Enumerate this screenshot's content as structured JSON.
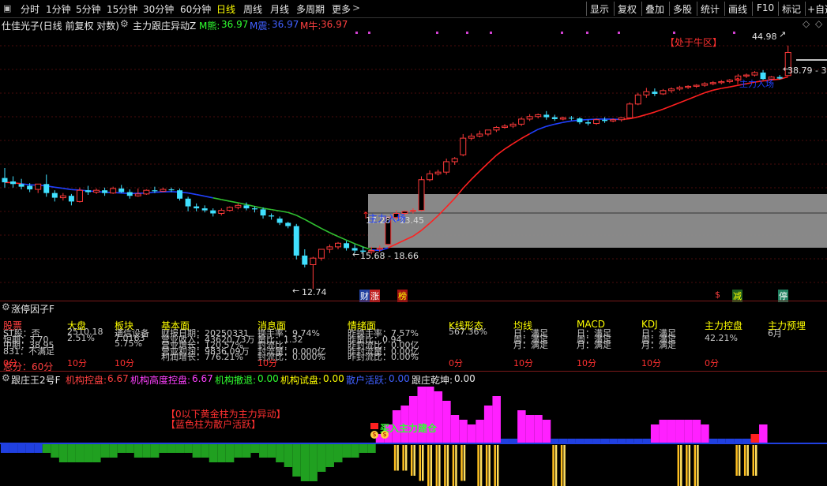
{
  "toolbar": {
    "timeframes": [
      "分时",
      "1分钟",
      "5分钟",
      "15分钟",
      "30分钟",
      "60分钟",
      "日线",
      "周线",
      "月线",
      "多周期",
      "更多"
    ],
    "active_timeframe": "日线",
    "more_arrow": ">",
    "right_buttons": [
      "显示",
      "复权",
      "叠加",
      "多股",
      "统计",
      "画线",
      "F10",
      "标记",
      "+自选"
    ]
  },
  "main_header": {
    "title": "仕佳光子(日线 前复权 对数)",
    "indicator_name": "主力跟庄异动Z",
    "values": [
      {
        "label": "M熊:",
        "value": "36.97",
        "color": "#30ff30"
      },
      {
        "label": "M震:",
        "value": "36.97",
        "color": "#4060ff"
      },
      {
        "label": "M牛:",
        "value": "36.97",
        "color": "#ff4040"
      }
    ],
    "nav_icons": [
      "◇",
      "◇"
    ]
  },
  "main_chart": {
    "annotations": {
      "bull_zone": "【处于牛区】",
      "high_price": "44.98",
      "price_range_right": "38.79 - 3",
      "entry_right": "主力入场",
      "entry_left": "主力入场",
      "zone_range_top": "17.28 - 13.45",
      "zone_range_bottom": "15.68 - 18.66",
      "low_price": "12.74",
      "tag_cai": "财",
      "tag_zhang": "涨",
      "tag_bang": "榜",
      "tag_s": "$",
      "tag_jian": "减",
      "tag_ting": "停"
    },
    "candles": [
      {
        "o": 22.6,
        "h": 23.8,
        "c": 22.1,
        "l": 21.5
      },
      {
        "o": 22.2,
        "h": 22.8,
        "c": 21.9,
        "l": 21.5
      },
      {
        "o": 21.9,
        "h": 22.5,
        "c": 21.6,
        "l": 21.3
      },
      {
        "o": 21.7,
        "h": 22.0,
        "c": 21.3,
        "l": 21.0
      },
      {
        "o": 21.3,
        "h": 21.8,
        "c": 21.9,
        "l": 20.9
      },
      {
        "o": 21.9,
        "h": 23.0,
        "c": 20.9,
        "l": 20.5
      },
      {
        "o": 20.9,
        "h": 21.2,
        "c": 20.4,
        "l": 20.0
      },
      {
        "o": 20.4,
        "h": 20.9,
        "c": 20.6,
        "l": 20.1
      },
      {
        "o": 20.6,
        "h": 20.8,
        "c": 20.0,
        "l": 19.6
      },
      {
        "o": 20.0,
        "h": 21.5,
        "c": 21.2,
        "l": 19.9
      },
      {
        "o": 21.2,
        "h": 21.7,
        "c": 21.0,
        "l": 20.7
      },
      {
        "o": 21.0,
        "h": 21.4,
        "c": 21.2,
        "l": 20.8
      },
      {
        "o": 21.2,
        "h": 21.5,
        "c": 20.9,
        "l": 20.6
      },
      {
        "o": 20.9,
        "h": 21.6,
        "c": 21.4,
        "l": 20.8
      },
      {
        "o": 21.4,
        "h": 21.8,
        "c": 21.0,
        "l": 20.9
      },
      {
        "o": 21.0,
        "h": 21.3,
        "c": 20.6,
        "l": 20.3
      },
      {
        "o": 20.6,
        "h": 21.4,
        "c": 20.8,
        "l": 20.5
      },
      {
        "o": 20.8,
        "h": 21.3,
        "c": 21.2,
        "l": 20.7
      },
      {
        "o": 21.2,
        "h": 21.6,
        "c": 21.1,
        "l": 20.9
      },
      {
        "o": 21.1,
        "h": 21.5,
        "c": 21.3,
        "l": 21.0
      },
      {
        "o": 21.3,
        "h": 21.5,
        "c": 21.2,
        "l": 21.0
      },
      {
        "o": 21.2,
        "h": 21.4,
        "c": 20.3,
        "l": 20.1
      },
      {
        "o": 20.3,
        "h": 20.5,
        "c": 19.5,
        "l": 19.0
      },
      {
        "o": 19.5,
        "h": 19.8,
        "c": 19.3,
        "l": 19.0
      },
      {
        "o": 19.3,
        "h": 19.6,
        "c": 19.1,
        "l": 18.9
      },
      {
        "o": 19.1,
        "h": 19.3,
        "c": 18.8,
        "l": 18.5
      },
      {
        "o": 18.8,
        "h": 19.3,
        "c": 19.1,
        "l": 18.6
      },
      {
        "o": 19.1,
        "h": 19.5,
        "c": 19.4,
        "l": 19.0
      },
      {
        "o": 19.4,
        "h": 19.8,
        "c": 19.6,
        "l": 19.2
      },
      {
        "o": 19.6,
        "h": 19.9,
        "c": 19.3,
        "l": 19.1
      },
      {
        "o": 19.3,
        "h": 19.5,
        "c": 19.2,
        "l": 18.9
      },
      {
        "o": 19.2,
        "h": 19.4,
        "c": 18.6,
        "l": 18.3
      },
      {
        "o": 18.6,
        "h": 18.8,
        "c": 18.5,
        "l": 18.2
      },
      {
        "o": 18.3,
        "h": 18.5,
        "c": 17.9,
        "l": 17.7
      },
      {
        "o": 17.9,
        "h": 18.0,
        "c": 17.6,
        "l": 17.4
      },
      {
        "o": 17.6,
        "h": 17.8,
        "c": 15.1,
        "l": 14.8
      },
      {
        "o": 15.1,
        "h": 15.6,
        "c": 14.4,
        "l": 14.2
      },
      {
        "o": 14.4,
        "h": 15.0,
        "c": 14.9,
        "l": 12.7
      },
      {
        "o": 14.9,
        "h": 15.2,
        "c": 15.6,
        "l": 14.7
      },
      {
        "o": 15.6,
        "h": 16.0,
        "c": 15.8,
        "l": 15.3
      },
      {
        "o": 15.8,
        "h": 16.2,
        "c": 16.1,
        "l": 15.6
      },
      {
        "o": 16.1,
        "h": 16.3,
        "c": 15.7,
        "l": 15.5
      },
      {
        "o": 15.7,
        "h": 16.0,
        "c": 15.5,
        "l": 15.3
      },
      {
        "o": 15.5,
        "h": 15.8,
        "c": 15.4,
        "l": 15.1
      },
      {
        "o": 15.4,
        "h": 15.8,
        "c": 15.5,
        "l": 15.2
      },
      {
        "o": 15.6,
        "h": 15.9,
        "c": 15.7,
        "l": 15.4
      },
      {
        "o": 16.0,
        "h": 18.5,
        "c": 18.4,
        "l": 15.9
      },
      {
        "o": 18.4,
        "h": 19.1,
        "c": 18.8,
        "l": 18.2
      },
      {
        "o": 18.8,
        "h": 19.1,
        "c": 19.0,
        "l": 18.6
      },
      {
        "o": 19.0,
        "h": 19.3,
        "c": 19.1,
        "l": 18.8
      },
      {
        "o": 19.1,
        "h": 22.8,
        "c": 22.4,
        "l": 19.0
      },
      {
        "o": 22.4,
        "h": 23.5,
        "c": 23.1,
        "l": 22.2
      },
      {
        "o": 23.1,
        "h": 23.6,
        "c": 23.3,
        "l": 22.9
      },
      {
        "o": 23.3,
        "h": 25.0,
        "c": 24.6,
        "l": 23.0
      },
      {
        "o": 24.6,
        "h": 25.2,
        "c": 25.0,
        "l": 24.2
      },
      {
        "o": 25.5,
        "h": 28.4,
        "c": 27.8,
        "l": 25.3
      },
      {
        "o": 27.8,
        "h": 28.5,
        "c": 28.1,
        "l": 27.5
      },
      {
        "o": 28.1,
        "h": 28.9,
        "c": 28.4,
        "l": 27.9
      },
      {
        "o": 28.4,
        "h": 28.9,
        "c": 29.0,
        "l": 28.1
      },
      {
        "o": 29.0,
        "h": 29.6,
        "c": 29.4,
        "l": 28.7
      },
      {
        "o": 29.4,
        "h": 29.9,
        "c": 29.6,
        "l": 29.2
      },
      {
        "o": 29.6,
        "h": 30.2,
        "c": 29.9,
        "l": 29.3
      },
      {
        "o": 29.9,
        "h": 31.0,
        "c": 30.7,
        "l": 29.6
      },
      {
        "o": 30.7,
        "h": 31.5,
        "c": 31.1,
        "l": 30.4
      },
      {
        "o": 31.1,
        "h": 31.6,
        "c": 31.4,
        "l": 30.8
      },
      {
        "o": 31.4,
        "h": 32.0,
        "c": 31.0,
        "l": 30.6
      },
      {
        "o": 31.0,
        "h": 31.4,
        "c": 30.7,
        "l": 30.4
      },
      {
        "o": 30.7,
        "h": 31.1,
        "c": 30.9,
        "l": 30.5
      },
      {
        "o": 30.9,
        "h": 31.2,
        "c": 30.8,
        "l": 30.5
      },
      {
        "o": 30.8,
        "h": 31.0,
        "c": 30.2,
        "l": 29.9
      },
      {
        "o": 30.2,
        "h": 30.6,
        "c": 30.0,
        "l": 29.7
      },
      {
        "o": 30.0,
        "h": 30.8,
        "c": 30.6,
        "l": 29.8
      },
      {
        "o": 30.6,
        "h": 31.0,
        "c": 30.4,
        "l": 30.1
      },
      {
        "o": 30.4,
        "h": 30.8,
        "c": 30.6,
        "l": 30.2
      },
      {
        "o": 30.6,
        "h": 31.0,
        "c": 30.9,
        "l": 30.3
      },
      {
        "o": 30.9,
        "h": 33.5,
        "c": 33.2,
        "l": 30.8
      },
      {
        "o": 33.2,
        "h": 35.2,
        "c": 34.8,
        "l": 33.0
      },
      {
        "o": 34.8,
        "h": 36.1,
        "c": 35.4,
        "l": 34.3
      },
      {
        "o": 35.4,
        "h": 36.0,
        "c": 35.0,
        "l": 34.6
      },
      {
        "o": 35.0,
        "h": 35.9,
        "c": 35.6,
        "l": 34.8
      },
      {
        "o": 35.6,
        "h": 36.2,
        "c": 35.9,
        "l": 35.2
      },
      {
        "o": 35.9,
        "h": 36.5,
        "c": 36.2,
        "l": 35.6
      },
      {
        "o": 36.2,
        "h": 36.6,
        "c": 36.4,
        "l": 35.9
      },
      {
        "o": 36.4,
        "h": 36.8,
        "c": 36.6,
        "l": 36.1
      },
      {
        "o": 36.6,
        "h": 37.2,
        "c": 36.9,
        "l": 36.3
      },
      {
        "o": 36.9,
        "h": 37.4,
        "c": 37.1,
        "l": 36.6
      },
      {
        "o": 37.1,
        "h": 37.6,
        "c": 37.3,
        "l": 36.8
      },
      {
        "o": 37.3,
        "h": 37.8,
        "c": 37.6,
        "l": 37.0
      },
      {
        "o": 37.6,
        "h": 38.8,
        "c": 38.4,
        "l": 37.3
      },
      {
        "o": 38.4,
        "h": 38.9,
        "c": 38.6,
        "l": 38.0
      },
      {
        "o": 38.6,
        "h": 39.4,
        "c": 39.1,
        "l": 38.3
      },
      {
        "o": 39.1,
        "h": 39.6,
        "c": 37.8,
        "l": 37.6
      },
      {
        "o": 37.8,
        "h": 38.4,
        "c": 38.2,
        "l": 37.5
      },
      {
        "o": 38.2,
        "h": 38.6,
        "c": 37.9,
        "l": 37.7
      },
      {
        "o": 38.5,
        "h": 45.0,
        "c": 43.4,
        "l": 38.4
      }
    ]
  },
  "factor_panel": {
    "title": "涨停因子F",
    "headers": [
      {
        "text": "股票",
        "color": "#ff4040"
      },
      {
        "text": "大盘",
        "color": "#ffff00"
      },
      {
        "text": "板块",
        "color": "#ffff00"
      },
      {
        "text": "基本面",
        "color": "#ffff00"
      },
      {
        "text": "消息面",
        "color": "#ffff00"
      },
      {
        "text": "情绪面",
        "color": "#ffff00"
      },
      {
        "text": "K线形态",
        "color": "#ffff00"
      },
      {
        "text": "均线",
        "color": "#ffff00"
      },
      {
        "text": "MACD",
        "color": "#ffff00"
      },
      {
        "text": "KDJ",
        "color": "#ffff00"
      },
      {
        "text": "主力控盘",
        "color": "#ffff00"
      },
      {
        "text": "主力预埋",
        "color": "#ffff00"
      }
    ],
    "rows": [
      [
        "ST股：否",
        "2510.18",
        "通信设备",
        "财报日期：20250331",
        "换手率：9.74%",
        "昨换手率：7.57%",
        "567.36%",
        "日：满足",
        "日：满足",
        "日：满足",
        "",
        "6月"
      ],
      [
        "短期：3.70",
        "2.51%",
        "7.0163",
        "营业收入：43620.73万",
        "量比：1.32",
        "昨量比：0.94",
        "",
        "周：满足",
        "周：满足",
        "周：满足",
        "42.21%",
        ""
      ],
      [
        "中期：38.95",
        "",
        "5.75%",
        "营业增长：120.57%",
        "封流比：",
        "昨封流比：0.00亿",
        "",
        "月：满足",
        "月：满足",
        "月：满足",
        "",
        ""
      ],
      [
        "831：不满足",
        "",
        "",
        "营业利润：9836.09万",
        "封流量：0.000亿",
        "昨封流量：0.00亿",
        "",
        "",
        "",
        "",
        "",
        ""
      ],
      [
        "",
        "",
        "",
        "利润增长：776.21%",
        "封流比：0.000%",
        "昨封流比：0.00%",
        "",
        "",
        "",
        "",
        "",
        ""
      ]
    ],
    "scores": [
      "0分",
      "10分",
      "10分",
      "",
      "10分",
      "",
      "0分",
      "10分",
      "10分",
      "10分",
      "0分",
      ""
    ],
    "total": "总分：60分"
  },
  "lower_panel": {
    "title": "跟庄王2号F",
    "values": [
      {
        "label": "机构控盘:",
        "value": "6.67",
        "color": "#ff4040"
      },
      {
        "label": "机构高度控盘:",
        "value": "6.67",
        "color": "#ff40ff"
      },
      {
        "label": "机构撤退:",
        "value": "0.00",
        "color": "#30ff30"
      },
      {
        "label": "机构试盘:",
        "value": "0.00",
        "color": "#ffff00"
      },
      {
        "label": "散户活跃:",
        "value": "0.00",
        "color": "#4060ff"
      },
      {
        "label": "跟庄乾坤:",
        "value": "0.00",
        "color": "#e8e8e8"
      }
    ],
    "note_line1": "【0以下黄金柱为主力异动】",
    "note_line2": "【蓝色柱为散户活跃】",
    "callout": "买入主力建仓",
    "bars": [
      {
        "v": -2,
        "c": "blue"
      },
      {
        "v": -2,
        "c": "blue"
      },
      {
        "v": -2,
        "c": "blue"
      },
      {
        "v": -2,
        "c": "blue"
      },
      {
        "v": -2,
        "c": "blue"
      },
      {
        "v": -2,
        "c": "green"
      },
      {
        "v": -3,
        "c": "green"
      },
      {
        "v": -4,
        "c": "green"
      },
      {
        "v": -4,
        "c": "green"
      },
      {
        "v": -4,
        "c": "green"
      },
      {
        "v": -4,
        "c": "green"
      },
      {
        "v": -4,
        "c": "green"
      },
      {
        "v": -3,
        "c": "green"
      },
      {
        "v": -3,
        "c": "green"
      },
      {
        "v": -2,
        "c": "green"
      },
      {
        "v": -2,
        "c": "green"
      },
      {
        "v": -3,
        "c": "green"
      },
      {
        "v": -3,
        "c": "green"
      },
      {
        "v": -3,
        "c": "green"
      },
      {
        "v": -2,
        "c": "green"
      },
      {
        "v": -2,
        "c": "green"
      },
      {
        "v": -2,
        "c": "green"
      },
      {
        "v": -2,
        "c": "green"
      },
      {
        "v": -3,
        "c": "green"
      },
      {
        "v": -3,
        "c": "green"
      },
      {
        "v": -4,
        "c": "green"
      },
      {
        "v": -4,
        "c": "green"
      },
      {
        "v": -4,
        "c": "green"
      },
      {
        "v": -3,
        "c": "green"
      },
      {
        "v": -3,
        "c": "green"
      },
      {
        "v": -2,
        "c": "green"
      },
      {
        "v": -3,
        "c": "green"
      },
      {
        "v": -3,
        "c": "green"
      },
      {
        "v": -4,
        "c": "green"
      },
      {
        "v": -5,
        "c": "green"
      },
      {
        "v": -7,
        "c": "green"
      },
      {
        "v": -8,
        "c": "green"
      },
      {
        "v": -8,
        "c": "green"
      },
      {
        "v": -6,
        "c": "green"
      },
      {
        "v": -5,
        "c": "green"
      },
      {
        "v": -4,
        "c": "green"
      },
      {
        "v": -3,
        "c": "green"
      },
      {
        "v": -3,
        "c": "green"
      },
      {
        "v": -2,
        "c": "green"
      },
      {
        "v": -2,
        "c": "green"
      },
      {
        "v": 2,
        "c": "magenta"
      },
      {
        "v": 4,
        "c": "magenta"
      },
      {
        "v": 7,
        "c": "magenta"
      },
      {
        "v": 8,
        "c": "magenta"
      },
      {
        "v": 10,
        "c": "magenta"
      },
      {
        "v": 12,
        "c": "magenta"
      },
      {
        "v": 12,
        "c": "magenta"
      },
      {
        "v": 11,
        "c": "magenta"
      },
      {
        "v": 9,
        "c": "magenta"
      },
      {
        "v": 6,
        "c": "magenta"
      },
      {
        "v": 5,
        "c": "magenta"
      },
      {
        "v": 4,
        "c": "magenta"
      },
      {
        "v": 5,
        "c": "magenta"
      },
      {
        "v": 8,
        "c": "magenta"
      },
      {
        "v": 10,
        "c": "magenta"
      },
      {
        "v": 1,
        "c": "blue"
      },
      {
        "v": 1,
        "c": "blue"
      },
      {
        "v": 7,
        "c": "magenta"
      },
      {
        "v": 6,
        "c": "magenta"
      },
      {
        "v": 6,
        "c": "magenta"
      },
      {
        "v": 5,
        "c": "magenta"
      },
      {
        "v": 1,
        "c": "blue"
      },
      {
        "v": 1,
        "c": "blue"
      },
      {
        "v": 1,
        "c": "blue"
      },
      {
        "v": 1,
        "c": "blue"
      },
      {
        "v": 1,
        "c": "blue"
      },
      {
        "v": 1,
        "c": "blue"
      },
      {
        "v": 1,
        "c": "blue"
      },
      {
        "v": 1,
        "c": "blue"
      },
      {
        "v": 1,
        "c": "blue"
      },
      {
        "v": 1,
        "c": "blue"
      },
      {
        "v": 1,
        "c": "blue"
      },
      {
        "v": 1,
        "c": "blue"
      },
      {
        "v": 4,
        "c": "magenta"
      },
      {
        "v": 5,
        "c": "magenta"
      },
      {
        "v": 5,
        "c": "magenta"
      },
      {
        "v": 5,
        "c": "magenta"
      },
      {
        "v": 5,
        "c": "magenta"
      },
      {
        "v": 5,
        "c": "magenta"
      },
      {
        "v": 4,
        "c": "magenta"
      },
      {
        "v": 1,
        "c": "blue"
      },
      {
        "v": 1,
        "c": "blue"
      },
      {
        "v": 1,
        "c": "blue"
      },
      {
        "v": 1,
        "c": "blue"
      },
      {
        "v": 1,
        "c": "blue"
      },
      {
        "v": 2,
        "c": "red"
      },
      {
        "v": 4,
        "c": "magenta"
      }
    ],
    "gold_bars": [
      {
        "i": 45,
        "v": 0
      },
      {
        "i": 47,
        "v": 5
      },
      {
        "i": 48,
        "v": 5
      },
      {
        "i": 49,
        "v": 6
      },
      {
        "i": 50,
        "v": 7
      },
      {
        "i": 51,
        "v": 8
      },
      {
        "i": 52,
        "v": 8
      },
      {
        "i": 53,
        "v": 8
      },
      {
        "i": 54,
        "v": 8
      },
      {
        "i": 55,
        "v": 7
      },
      {
        "i": 57,
        "v": 8
      },
      {
        "i": 58,
        "v": 8
      },
      {
        "i": 59,
        "v": 8
      },
      {
        "i": 66,
        "v": 8
      },
      {
        "i": 67,
        "v": 8
      },
      {
        "i": 81,
        "v": 8
      },
      {
        "i": 82,
        "v": 8
      },
      {
        "i": 83,
        "v": 8
      },
      {
        "i": 88,
        "v": 6
      },
      {
        "i": 89,
        "v": 6
      },
      {
        "i": 90,
        "v": 6
      }
    ]
  }
}
